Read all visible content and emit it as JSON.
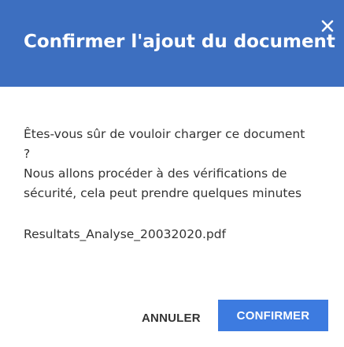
{
  "dialog": {
    "title": "Confirmer l'ajout du document",
    "question_line1": "Êtes-vous sûr de vouloir charger ce document",
    "question_line2": "?",
    "info_line1": "Nous allons procéder à des vérifications de",
    "info_line2": "sécurité, cela peut prendre quelques minutes",
    "filename": "Resultats_Analyse_20032020.pdf",
    "cancel_label": "ANNULER",
    "confirm_label": "CONFIRMER",
    "close_icon": "close-icon"
  },
  "colors": {
    "header": "#3d6fc0",
    "confirm_button": "#3d7be0",
    "text": "#333333"
  }
}
